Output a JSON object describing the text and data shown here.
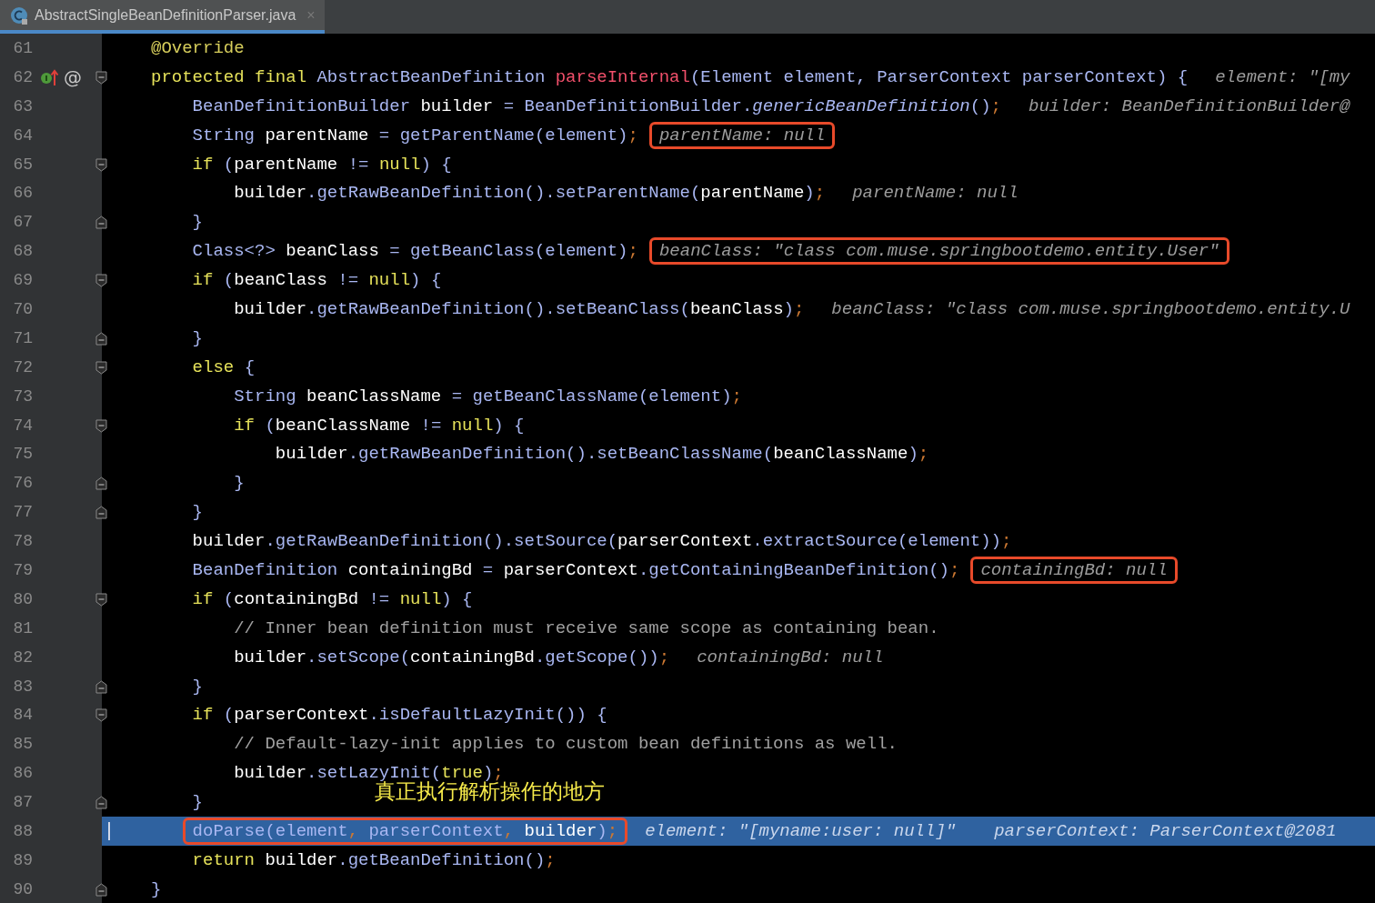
{
  "tab": {
    "title": "AbstractSingleBeanDefinitionParser.java",
    "close": "×",
    "selected": true
  },
  "lines": [
    {
      "number": "61",
      "tokens": [
        {
          "kind": "annotation",
          "text": "@Override"
        }
      ]
    },
    {
      "number": "62",
      "fold_start": true,
      "overrides": true,
      "gutter_symbol": "@",
      "tokens": [
        {
          "kind": "keyword",
          "text": "protected final "
        },
        {
          "kind": "plain",
          "text": "AbstractBeanDefinition "
        },
        {
          "kind": "decl",
          "text": "parseInternal"
        },
        {
          "kind": "plain",
          "text": "(Element element, ParserContext parserContext) {"
        }
      ],
      "hints": [
        {
          "text": "element: \"[my",
          "boxed": false
        }
      ]
    },
    {
      "number": "63",
      "tokens": [
        {
          "kind": "plain",
          "text": "    BeanDefinitionBuilder "
        },
        {
          "kind": "ident",
          "text": "builder"
        },
        {
          "kind": "plain",
          "text": " = BeanDefinitionBuilder."
        },
        {
          "kind": "italic",
          "text": "genericBeanDefinition"
        },
        {
          "kind": "plain",
          "text": "()"
        },
        {
          "kind": "sep",
          "text": ";"
        }
      ],
      "hints": [
        {
          "text": "builder: BeanDefinitionBuilder@",
          "boxed": false
        }
      ]
    },
    {
      "number": "64",
      "tokens": [
        {
          "kind": "plain",
          "text": "    String "
        },
        {
          "kind": "ident",
          "text": "parentName"
        },
        {
          "kind": "plain",
          "text": " = getParentName(element)"
        },
        {
          "kind": "sep",
          "text": ";"
        }
      ],
      "hints": [
        {
          "text": "parentName: null",
          "boxed": true
        }
      ]
    },
    {
      "number": "65",
      "fold_start": true,
      "tokens": [
        {
          "kind": "keyword",
          "text": "    if "
        },
        {
          "kind": "plain",
          "text": "("
        },
        {
          "kind": "ident",
          "text": "parentName"
        },
        {
          "kind": "plain",
          "text": " != "
        },
        {
          "kind": "keyword",
          "text": "null"
        },
        {
          "kind": "plain",
          "text": ") {"
        }
      ]
    },
    {
      "number": "66",
      "tokens": [
        {
          "kind": "ident",
          "text": "        builder"
        },
        {
          "kind": "plain",
          "text": ".getRawBeanDefinition().setParentName("
        },
        {
          "kind": "ident",
          "text": "parentName"
        },
        {
          "kind": "plain",
          "text": ")"
        },
        {
          "kind": "sep",
          "text": ";"
        }
      ],
      "hints": [
        {
          "text": "parentName: null",
          "boxed": false
        }
      ]
    },
    {
      "number": "67",
      "fold_end": true,
      "tokens": [
        {
          "kind": "plain",
          "text": "    }"
        }
      ]
    },
    {
      "number": "68",
      "tokens": [
        {
          "kind": "plain",
          "text": "    Class<?> "
        },
        {
          "kind": "ident",
          "text": "beanClass"
        },
        {
          "kind": "plain",
          "text": " = getBeanClass(element)"
        },
        {
          "kind": "sep",
          "text": ";"
        }
      ],
      "hints": [
        {
          "text": "beanClass: \"class com.muse.springbootdemo.entity.User\"",
          "boxed": true
        }
      ]
    },
    {
      "number": "69",
      "fold_start": true,
      "tokens": [
        {
          "kind": "keyword",
          "text": "    if "
        },
        {
          "kind": "plain",
          "text": "("
        },
        {
          "kind": "ident",
          "text": "beanClass"
        },
        {
          "kind": "plain",
          "text": " != "
        },
        {
          "kind": "keyword",
          "text": "null"
        },
        {
          "kind": "plain",
          "text": ") {"
        }
      ]
    },
    {
      "number": "70",
      "tokens": [
        {
          "kind": "ident",
          "text": "        builder"
        },
        {
          "kind": "plain",
          "text": ".getRawBeanDefinition().setBeanClass("
        },
        {
          "kind": "ident",
          "text": "beanClass"
        },
        {
          "kind": "plain",
          "text": ")"
        },
        {
          "kind": "sep",
          "text": ";"
        }
      ],
      "hints": [
        {
          "text": "beanClass: \"class com.muse.springbootdemo.entity.U",
          "boxed": false
        }
      ]
    },
    {
      "number": "71",
      "fold_end": true,
      "tokens": [
        {
          "kind": "plain",
          "text": "    }"
        }
      ]
    },
    {
      "number": "72",
      "fold_start": true,
      "tokens": [
        {
          "kind": "keyword",
          "text": "    else "
        },
        {
          "kind": "plain",
          "text": "{"
        }
      ]
    },
    {
      "number": "73",
      "tokens": [
        {
          "kind": "plain",
          "text": "        String "
        },
        {
          "kind": "ident",
          "text": "beanClassName"
        },
        {
          "kind": "plain",
          "text": " = getBeanClassName(element)"
        },
        {
          "kind": "sep",
          "text": ";"
        }
      ]
    },
    {
      "number": "74",
      "fold_start": true,
      "tokens": [
        {
          "kind": "keyword",
          "text": "        if "
        },
        {
          "kind": "plain",
          "text": "("
        },
        {
          "kind": "ident",
          "text": "beanClassName"
        },
        {
          "kind": "plain",
          "text": " != "
        },
        {
          "kind": "keyword",
          "text": "null"
        },
        {
          "kind": "plain",
          "text": ") {"
        }
      ]
    },
    {
      "number": "75",
      "tokens": [
        {
          "kind": "ident",
          "text": "            builder"
        },
        {
          "kind": "plain",
          "text": ".getRawBeanDefinition().setBeanClassName("
        },
        {
          "kind": "ident",
          "text": "beanClassName"
        },
        {
          "kind": "plain",
          "text": ")"
        },
        {
          "kind": "sep",
          "text": ";"
        }
      ]
    },
    {
      "number": "76",
      "fold_end": true,
      "tokens": [
        {
          "kind": "plain",
          "text": "        }"
        }
      ]
    },
    {
      "number": "77",
      "fold_end": true,
      "tokens": [
        {
          "kind": "plain",
          "text": "    }"
        }
      ]
    },
    {
      "number": "78",
      "tokens": [
        {
          "kind": "ident",
          "text": "    builder"
        },
        {
          "kind": "plain",
          "text": ".getRawBeanDefinition().setSource("
        },
        {
          "kind": "ident",
          "text": "parserContext"
        },
        {
          "kind": "plain",
          "text": ".extractSource(element))"
        },
        {
          "kind": "sep",
          "text": ";"
        }
      ]
    },
    {
      "number": "79",
      "tokens": [
        {
          "kind": "plain",
          "text": "    BeanDefinition "
        },
        {
          "kind": "ident",
          "text": "containingBd"
        },
        {
          "kind": "plain",
          "text": " = "
        },
        {
          "kind": "ident",
          "text": "parserContext"
        },
        {
          "kind": "plain",
          "text": ".getContainingBeanDefinition()"
        },
        {
          "kind": "sep",
          "text": ";"
        }
      ],
      "hints": [
        {
          "text": "containingBd: null",
          "boxed": true
        }
      ]
    },
    {
      "number": "80",
      "fold_start": true,
      "tokens": [
        {
          "kind": "keyword",
          "text": "    if "
        },
        {
          "kind": "plain",
          "text": "("
        },
        {
          "kind": "ident",
          "text": "containingBd"
        },
        {
          "kind": "plain",
          "text": " != "
        },
        {
          "kind": "keyword",
          "text": "null"
        },
        {
          "kind": "plain",
          "text": ") {"
        }
      ]
    },
    {
      "number": "81",
      "tokens": [
        {
          "kind": "comment",
          "text": "        // Inner bean definition must receive same scope as containing bean."
        }
      ]
    },
    {
      "number": "82",
      "tokens": [
        {
          "kind": "ident",
          "text": "        builder"
        },
        {
          "kind": "plain",
          "text": ".setScope("
        },
        {
          "kind": "ident",
          "text": "containingBd"
        },
        {
          "kind": "plain",
          "text": ".getScope())"
        },
        {
          "kind": "sep",
          "text": ";"
        }
      ],
      "hints": [
        {
          "text": "containingBd: null",
          "boxed": false
        }
      ]
    },
    {
      "number": "83",
      "fold_end": true,
      "tokens": [
        {
          "kind": "plain",
          "text": "    }"
        }
      ]
    },
    {
      "number": "84",
      "fold_start": true,
      "tokens": [
        {
          "kind": "keyword",
          "text": "    if "
        },
        {
          "kind": "plain",
          "text": "("
        },
        {
          "kind": "ident",
          "text": "parserContext"
        },
        {
          "kind": "plain",
          "text": ".isDefaultLazyInit()) {"
        }
      ]
    },
    {
      "number": "85",
      "tokens": [
        {
          "kind": "comment",
          "text": "        // Default-lazy-init applies to custom bean definitions as well."
        }
      ]
    },
    {
      "number": "86",
      "tokens": [
        {
          "kind": "ident",
          "text": "        builder"
        },
        {
          "kind": "plain",
          "text": ".setLazyInit("
        },
        {
          "kind": "keyword",
          "text": "true"
        },
        {
          "kind": "plain",
          "text": ")"
        },
        {
          "kind": "sep",
          "text": ";"
        }
      ]
    },
    {
      "number": "87",
      "fold_end": true,
      "tokens": [
        {
          "kind": "plain",
          "text": "    }"
        }
      ],
      "note": "真正执行解析操作的地方"
    },
    {
      "number": "88",
      "current": true,
      "boxed": true,
      "tokens": [
        {
          "kind": "plain",
          "text": "    doParse(element"
        },
        {
          "kind": "sep",
          "text": ", "
        },
        {
          "kind": "plain",
          "text": "parserContext"
        },
        {
          "kind": "sep",
          "text": ", "
        },
        {
          "kind": "ident",
          "text": "builder"
        },
        {
          "kind": "plain",
          "text": ")"
        },
        {
          "kind": "sep",
          "text": ";"
        }
      ],
      "hints": [
        {
          "text": "element: \"[myname:user: null]\"",
          "boxed": false
        },
        {
          "text": "parserContext: ParserContext@2081",
          "boxed": false
        }
      ]
    },
    {
      "number": "89",
      "tokens": [
        {
          "kind": "keyword",
          "text": "    return "
        },
        {
          "kind": "ident",
          "text": "builder"
        },
        {
          "kind": "plain",
          "text": ".getBeanDefinition()"
        },
        {
          "kind": "sep",
          "text": ";"
        }
      ]
    },
    {
      "number": "90",
      "fold_end": true,
      "tokens": [
        {
          "kind": "plain",
          "text": "}"
        }
      ]
    }
  ]
}
